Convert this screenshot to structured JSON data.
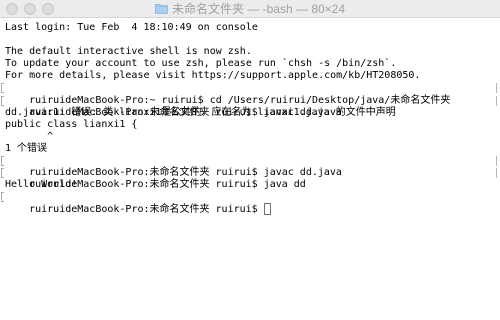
{
  "window": {
    "title": "未命名文件夹 — -bash — 80×24",
    "title_icon": "folder-icon"
  },
  "terminal": {
    "lines": [
      "Last login: Tue Feb  4 18:10:49 on console",
      "",
      "The default interactive shell is now zsh.",
      "To update your account to use zsh, please run `chsh -s /bin/zsh`.",
      "For more details, please visit https://support.apple.com/kb/HT208050.",
      "ruiruideMacBook-Pro:~ ruirui$ cd /Users/ruirui/Desktop/java/未命名文件夹",
      "ruiruideMacBook-Pro:未命名文件夹 ruirui$ javac dd.java",
      "dd.java:1: 错误: 类 lianxi1是公共的，应在名为 lianxi1.java 的文件中声明",
      "public class lianxi1 {",
      "       ^",
      "1 个错误",
      "ruiruideMacBook-Pro:未命名文件夹 ruirui$ javac dd.java",
      "ruiruideMacBook-Pro:未命名文件夹 ruirui$ java dd",
      "Hello World!",
      "ruiruideMacBook-Pro:未命名文件夹 ruirui$ "
    ]
  }
}
